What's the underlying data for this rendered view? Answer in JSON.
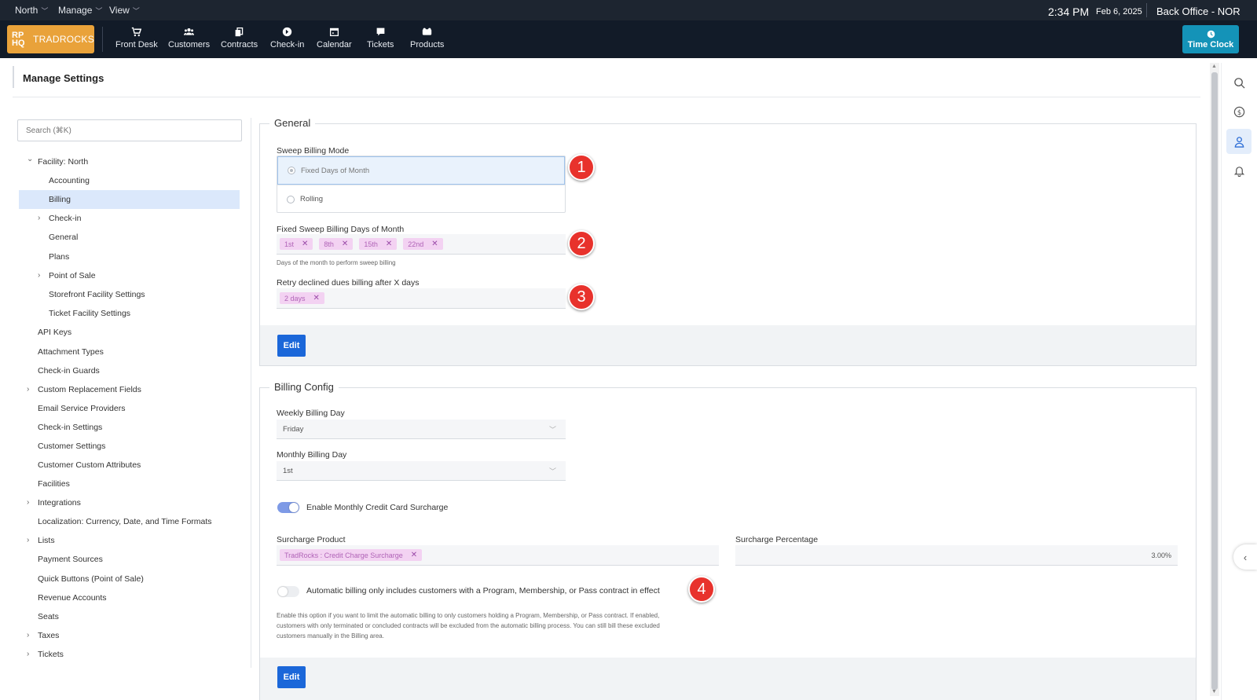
{
  "topbar": {
    "menus": [
      "North",
      "Manage",
      "View"
    ],
    "time": "2:34 PM",
    "date": "Feb 6, 2025",
    "office": "Back Office - NOR"
  },
  "navbar": {
    "logo_mark": "RP HQ",
    "logo_text": "TRADROCKS",
    "items": [
      {
        "label": "Front Desk",
        "icon": "cart-icon"
      },
      {
        "label": "Customers",
        "icon": "users-icon"
      },
      {
        "label": "Contracts",
        "icon": "contracts-icon"
      },
      {
        "label": "Check-in",
        "icon": "checkin-icon"
      },
      {
        "label": "Calendar",
        "icon": "calendar-icon"
      },
      {
        "label": "Tickets",
        "icon": "chat-icon"
      },
      {
        "label": "Products",
        "icon": "products-icon"
      }
    ],
    "time_clock": "Time Clock"
  },
  "page": {
    "title": "Manage Settings"
  },
  "sidebar": {
    "search_placeholder": "Search (⌘K)",
    "items": [
      {
        "label": "Facility: North",
        "expanded": true
      },
      {
        "label": "Accounting"
      },
      {
        "label": "Billing",
        "selected": true
      },
      {
        "label": "Check-in",
        "expandable": true
      },
      {
        "label": "General"
      },
      {
        "label": "Plans"
      },
      {
        "label": "Point of Sale",
        "expandable": true
      },
      {
        "label": "Storefront Facility Settings"
      },
      {
        "label": "Ticket Facility Settings"
      },
      {
        "label": "API Keys"
      },
      {
        "label": "Attachment Types"
      },
      {
        "label": "Check-in Guards"
      },
      {
        "label": "Custom Replacement Fields",
        "expandable": true
      },
      {
        "label": "Email Service Providers"
      },
      {
        "label": "Check-in Settings"
      },
      {
        "label": "Customer Settings"
      },
      {
        "label": "Customer Custom Attributes"
      },
      {
        "label": "Facilities"
      },
      {
        "label": "Integrations",
        "expandable": true
      },
      {
        "label": "Localization: Currency, Date, and Time Formats"
      },
      {
        "label": "Lists",
        "expandable": true
      },
      {
        "label": "Payment Sources"
      },
      {
        "label": "Quick Buttons (Point of Sale)"
      },
      {
        "label": "Revenue Accounts"
      },
      {
        "label": "Seats"
      },
      {
        "label": "Taxes",
        "expandable": true
      },
      {
        "label": "Tickets",
        "expandable": true
      }
    ]
  },
  "general": {
    "title": "General",
    "sweep_mode_label": "Sweep Billing Mode",
    "option_fixed": "Fixed Days of Month",
    "option_rolling": "Rolling",
    "fixed_days_label": "Fixed Sweep Billing Days of Month",
    "fixed_days": [
      "1st",
      "8th",
      "15th",
      "22nd"
    ],
    "fixed_days_help": "Days of the month to perform sweep billing",
    "retry_label": "Retry declined dues billing after X days",
    "retry_value": "2 days",
    "edit": "Edit"
  },
  "billing_config": {
    "title": "Billing Config",
    "weekly_label": "Weekly Billing Day",
    "weekly_value": "Friday",
    "monthly_label": "Monthly Billing Day",
    "monthly_value": "1st",
    "surcharge_toggle_label": "Enable Monthly Credit Card Surcharge",
    "surcharge_toggle_on": true,
    "surcharge_product_label": "Surcharge Product",
    "surcharge_product_value": "TradRocks : Credit Charge Surcharge",
    "surcharge_pct_label": "Surcharge Percentage",
    "surcharge_pct_value": "3.00%",
    "auto_billing_label": "Automatic billing only includes customers with a Program, Membership, or Pass contract in effect",
    "auto_billing_on": false,
    "auto_billing_help_1": "Enable this option if you want to limit the automatic billing to only customers holding a Program, Membership, or Pass contract. If enabled,",
    "auto_billing_help_2": "customers with only terminated or concluded contracts will be excluded from the automatic billing process. You can still bill these excluded",
    "auto_billing_help_3": "customers manually in the Billing area.",
    "edit": "Edit"
  },
  "annotations": [
    "1",
    "2",
    "3",
    "4"
  ],
  "rightbar": {
    "icons": [
      "search-icon",
      "dollar-icon",
      "user-icon",
      "bell-icon"
    ],
    "collapse_icon": "chevron-left-icon"
  },
  "colors": {
    "accent": "#1b67d9",
    "logo": "#e9a23a",
    "time_clock": "#1493b8",
    "chip_bg": "#f3d2f2",
    "badge": "#e8322c",
    "nav_bg": "#121b28"
  }
}
